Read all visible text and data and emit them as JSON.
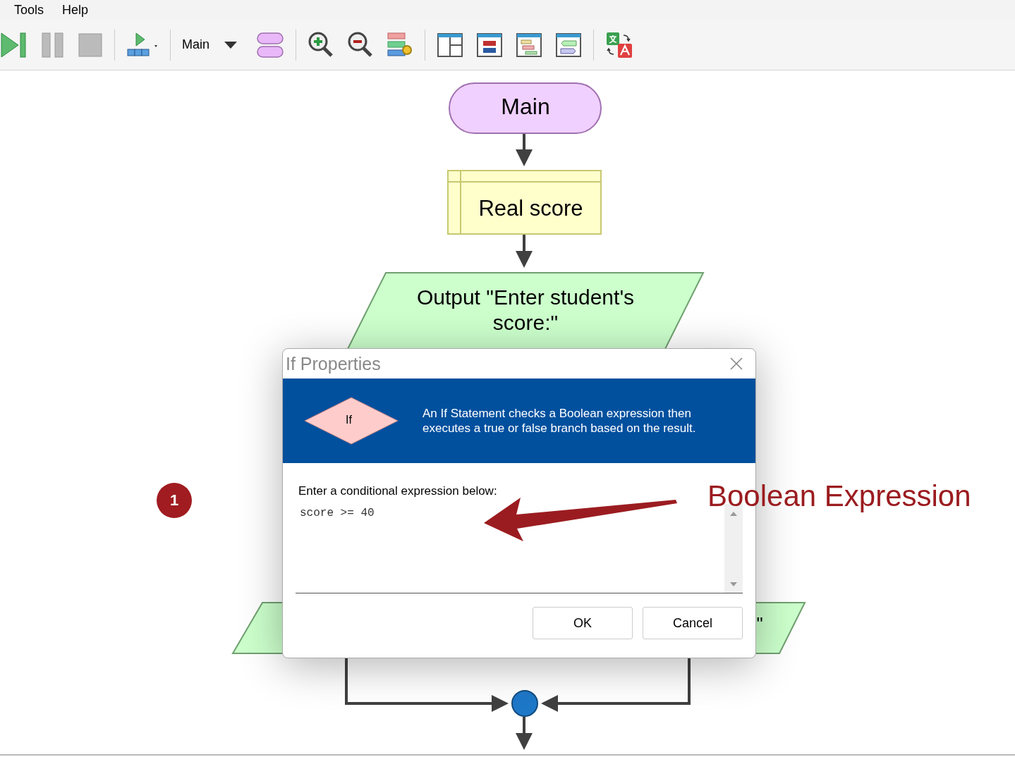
{
  "menu": [
    "Tools",
    "Help"
  ],
  "toolbar": {
    "function_select": "Main"
  },
  "flowchart": {
    "nodes": [
      {
        "kind": "terminal",
        "text": "Main"
      },
      {
        "kind": "declare",
        "text": "Real score"
      },
      {
        "kind": "output",
        "text": "Output \"Enter student's score:\""
      },
      {
        "kind": "output_left"
      },
      {
        "kind": "output_right",
        "text": "\""
      }
    ]
  },
  "dialog": {
    "title": "If Properties",
    "header_shape_label": "If",
    "description": "An If Statement checks a Boolean expression then executes a true or false branch based on the result.",
    "prompt": "Enter a conditional expression below:",
    "expression": "score >= 40",
    "buttons": [
      "OK",
      "Cancel"
    ]
  },
  "annotation": {
    "badge": "1",
    "label": "Boolean Expression"
  }
}
